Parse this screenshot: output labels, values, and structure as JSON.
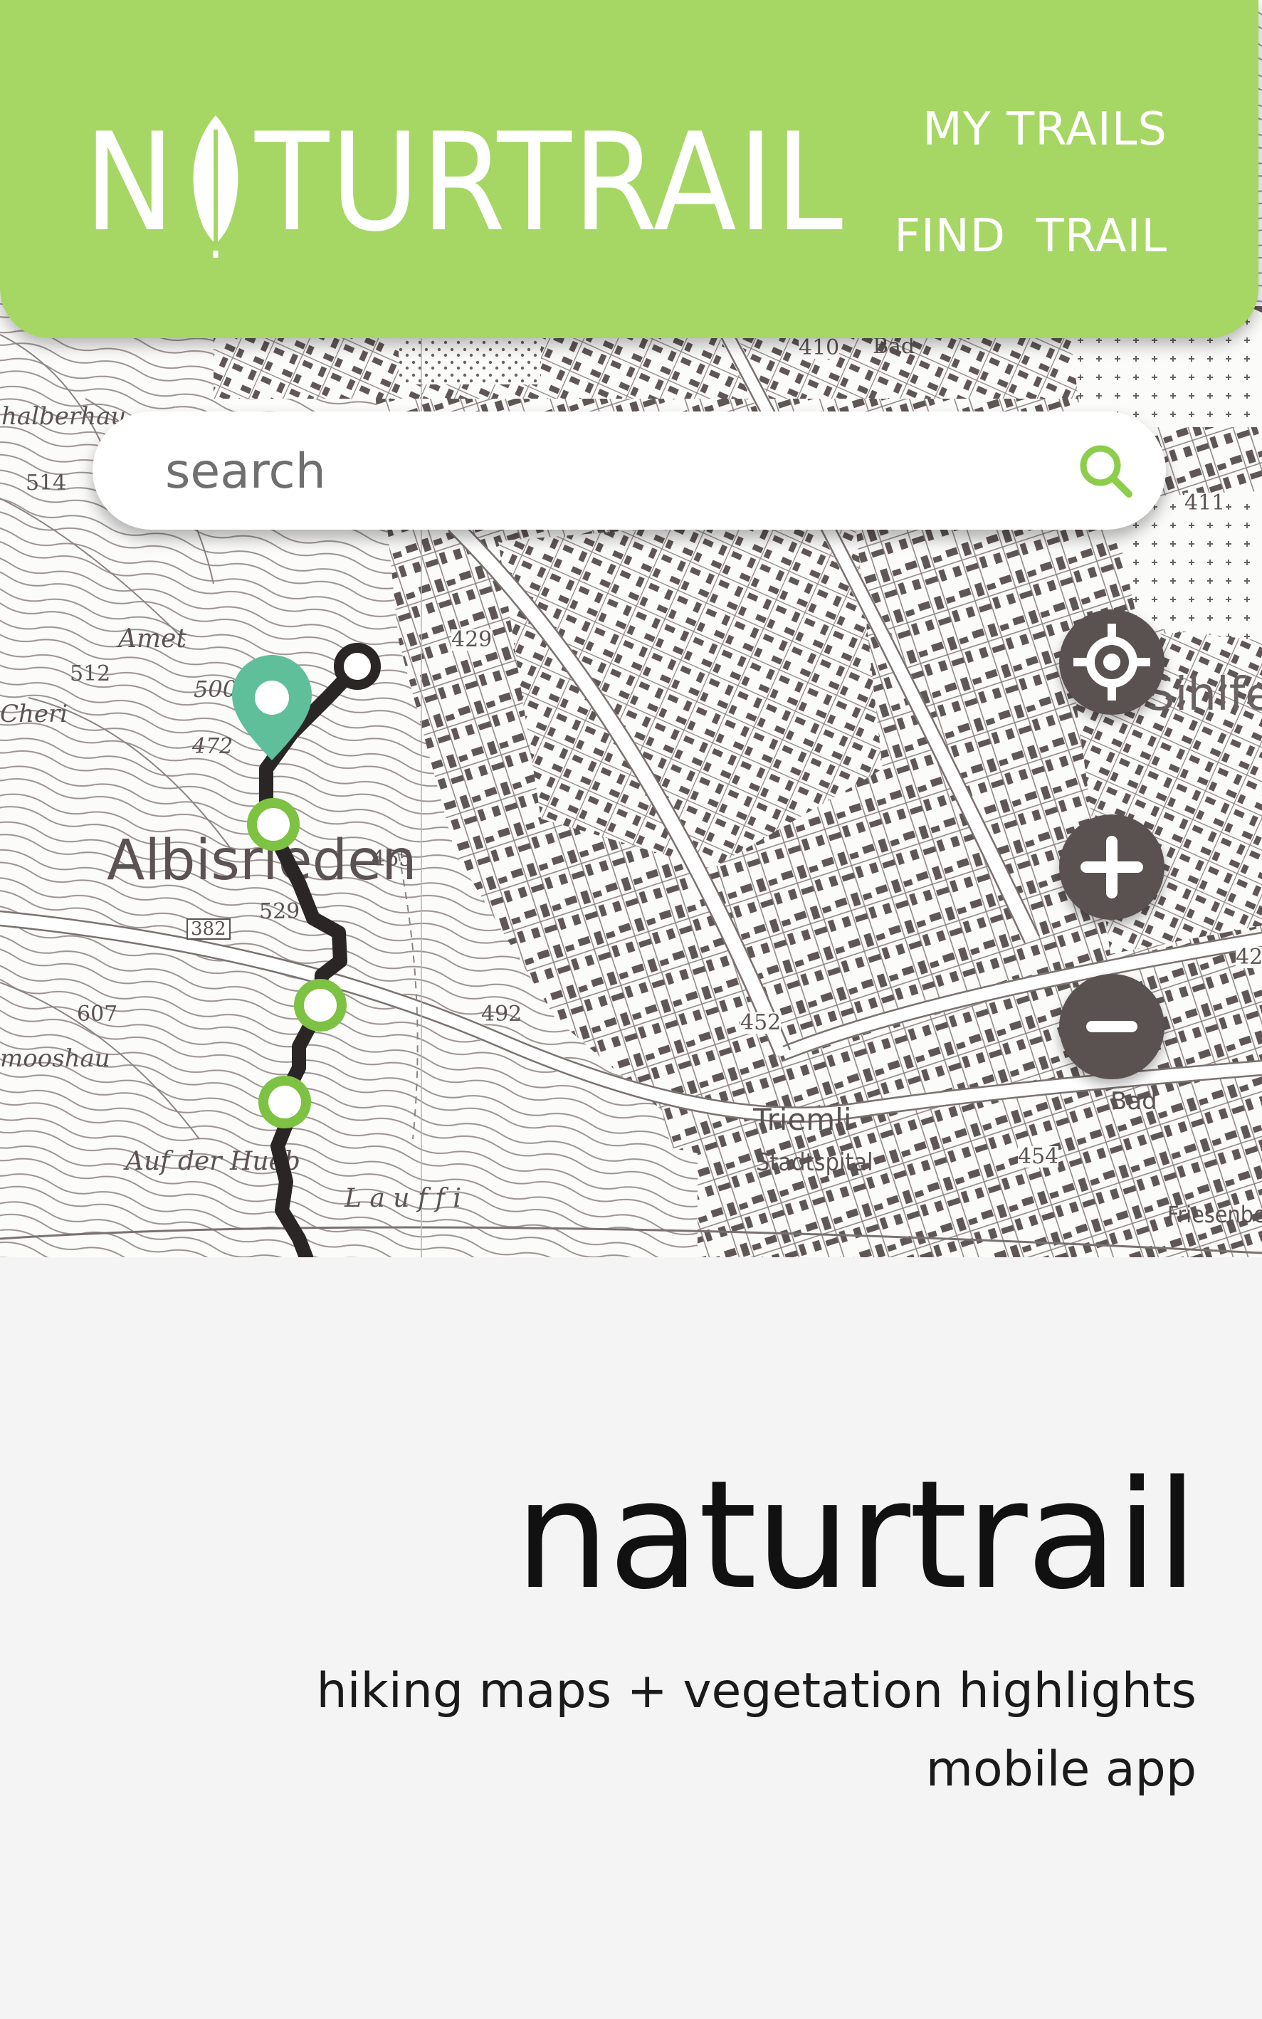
{
  "header": {
    "logo_text_1": "N",
    "logo_text_2": "TURTRAIL",
    "logo_alt": "NATURTRAIL",
    "nav": {
      "my_trails": "MY TRAILS",
      "find_trail": "FIND  TRAIL"
    }
  },
  "search": {
    "placeholder": "search"
  },
  "map": {
    "place_labels": {
      "albisrieden": "Albisrieden",
      "amet": "Amet",
      "halberhau": "halberhau",
      "cheri": "Cheri",
      "mooshau": "mooshau",
      "auf_der_hueb": "Auf der Hueb",
      "lauff": "L a u f f i",
      "triemli": "Triemli",
      "stadtspital": "Stadtspital",
      "sihlfe": "Sihlfe",
      "bad_top": "Bad",
      "bad_right": "Bad",
      "friesenbe": "Friesenbe"
    },
    "elevations": {
      "e514": "514",
      "e512": "512",
      "e500": "500",
      "e472": "472",
      "e429": "429",
      "e465": "465",
      "e529": "529",
      "e382": "382",
      "e607": "607",
      "e492": "492",
      "e452": "452",
      "e454": "454",
      "e410": "410",
      "e411": "411",
      "e42": "42"
    }
  },
  "controls": {
    "locate": "locate",
    "zoom_in": "zoom in",
    "zoom_out": "zoom out"
  },
  "colors": {
    "brand_green": "#a6d764",
    "route_dark": "#2b2626",
    "marker_teal": "#5fbf9a",
    "waypoint_green": "#7dc242",
    "control_bg": "#5a5151"
  },
  "footer": {
    "title": "naturtrail",
    "subtitle_line1": "hiking maps + vegetation highlights",
    "subtitle_line2": "mobile app"
  }
}
